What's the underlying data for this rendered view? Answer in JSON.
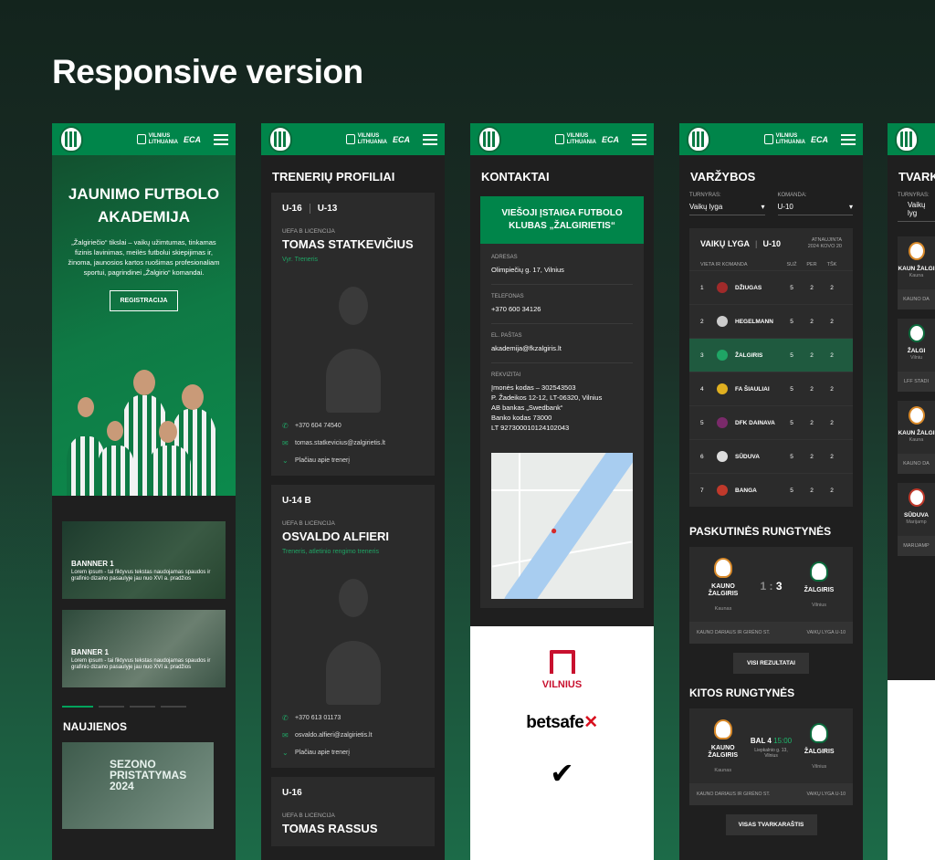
{
  "heading": "Responsive version",
  "header": {
    "brand_line1": "VILNIUS",
    "brand_line2": "LITHUANIA",
    "eca": "ECA"
  },
  "academy": {
    "title": "JAUNIMO FUTBOLO AKADEMIJA",
    "description": "„Žalgiriečio“ tikslai – vaikų užimtumas, tinkamas fizinis lavinimas, meilės futbolui skiepijimas ir, žinoma, jaunosios kartos ruošimas profesionaliam sportui, pagrindinei „Žalgirio“ komandai.",
    "register_label": "REGISTRACIJA",
    "banners": [
      {
        "title": "BANNNER 1",
        "text": "Lorem ipsum - tai fiktyvus tekstas naudojamas spaudos ir grafinio dizaino pasaulyje jau nuo XVI a. pradžios"
      },
      {
        "title": "BANNER 1",
        "text": "Lorem ipsum - tai fiktyvus tekstas naudojamas spaudos ir grafinio dizaino pasaulyje jau nuo XVI a. pradžios"
      }
    ],
    "news_title": "NAUJIENOS",
    "news_img_text": "SEZONO PRISTATYMAS 2024"
  },
  "coaches": {
    "title": "TRENERIŲ PROFILIAI",
    "list": [
      {
        "tab1": "U-16",
        "tab2": "U-13",
        "license": "UEFA B LICENCIJA",
        "name": "TOMAS STATKEVIČIUS",
        "role": "Vyr. Treneris",
        "phone": "+370 604 74540",
        "email": "tomas.statkevicius@zalgirietis.lt",
        "more": "Plačiau apie trenerį"
      },
      {
        "tab1": "U-14 B",
        "license": "UEFA B LICENCIJA",
        "name": "OSVALDO ALFIERI",
        "role": "Treneris, atletinio rengimo treneris",
        "phone": "+370 613 01173",
        "email": "osvaldo.alfieri@zalgirietis.lt",
        "more": "Plačiau apie trenerį"
      },
      {
        "tab1": "U-16",
        "license": "UEFA B LICENCIJA",
        "name": "TOMAS RASSUS"
      }
    ]
  },
  "contacts": {
    "title": "KONTAKTAI",
    "org": "VIEŠOJI ĮSTAIGA FUTBOLO KLUBAS „ŽALGIRIETIS“",
    "address_label": "ADRESAS",
    "address": "Olimpiečių g. 17, Vilnius",
    "phone_label": "TELEFONAS",
    "phone": "+370 600 34126",
    "email_label": "EL. PAŠTAS",
    "email": "akademija@fkzalgiris.lt",
    "req_label": "REKVIZITAI",
    "req": [
      "Įmonės kodas – 302543503",
      "P. Žadeikos 12-12, LT-06320, Vilnius",
      "AB bankas „Swedbank“",
      "Banko kodas 73000",
      "LT 927300010124102043"
    ],
    "sponsors": {
      "vilnius": "VILNIUS",
      "betsafe": "betsafe"
    }
  },
  "competitions": {
    "title": "VARŽYBOS",
    "tournament_label": "TURNYRAS:",
    "tournament": "Vaikų lyga",
    "team_label": "KOMANDA:",
    "team": "U-10",
    "table_title": "VAIKŲ LYGA",
    "table_group": "U-10",
    "updated_label": "ATNAUJINTA",
    "updated": "2024 KOVO 20",
    "cols": {
      "team": "VIETA IR KOMANDA",
      "w": "SUŽ",
      "l": "PER",
      "pts": "TŠK"
    },
    "rows": [
      {
        "pos": "1",
        "team": "DŽIUGAS",
        "w": "5",
        "l": "2",
        "pts": "2"
      },
      {
        "pos": "2",
        "team": "HEGELMANN",
        "w": "5",
        "l": "2",
        "pts": "2"
      },
      {
        "pos": "3",
        "team": "ŽALGIRIS",
        "w": "5",
        "l": "2",
        "pts": "2"
      },
      {
        "pos": "4",
        "team": "FA ŠIAULIAI",
        "w": "5",
        "l": "2",
        "pts": "2"
      },
      {
        "pos": "5",
        "team": "DFK DAINAVA",
        "w": "5",
        "l": "2",
        "pts": "2"
      },
      {
        "pos": "6",
        "team": "SŪDUVA",
        "w": "5",
        "l": "2",
        "pts": "2"
      },
      {
        "pos": "7",
        "team": "BANGA",
        "w": "5",
        "l": "2",
        "pts": "2"
      }
    ],
    "last_title": "PASKUTINĖS RUNGTYNĖS",
    "last": {
      "home": "KAUNO ŽALGIRIS",
      "home_city": "Kaunas",
      "score_home": "1",
      "score_sep": ":",
      "score_away": "3",
      "away": "ŽALGIRIS",
      "away_city": "Vilnius",
      "venue": "KAUNO DARIAUS IR GIRĖNO ST.",
      "league": "VAIKŲ LYGA U-10"
    },
    "all_results": "VISI REZULTATAI",
    "next_title": "KITOS RUNGTYNĖS",
    "next": {
      "home": "KAUNO ŽALGIRIS",
      "home_city": "Kaunas",
      "date": "BAL 4",
      "time": "15:00",
      "place": "Liepkalnio g. 13, Vilnius",
      "away": "ŽALGIRIS",
      "away_city": "Vilnius",
      "venue": "KAUNO DARIAUS IR GIRĖNO ST.",
      "league": "VAIKŲ LYGA U-10"
    },
    "all_schedule": "VISAS TVARKARAŠTIS"
  },
  "partial": {
    "title": "TVARK",
    "filter_label": "TURNYRAS:",
    "filter": "Vaikų lyg",
    "cards": [
      {
        "name": "KAUN ŽALGI",
        "city": "Kauna",
        "foot": "KAUNO DA"
      },
      {
        "name": "ŽALGI",
        "city": "Vilniu",
        "foot": "LFF STADI"
      },
      {
        "name": "KAUN ŽALGI",
        "city": "Kauna",
        "foot": "KAUNO DA"
      },
      {
        "name": "SŪDUVA",
        "city": "Marijamp",
        "foot": "MARIJAMP"
      }
    ]
  }
}
